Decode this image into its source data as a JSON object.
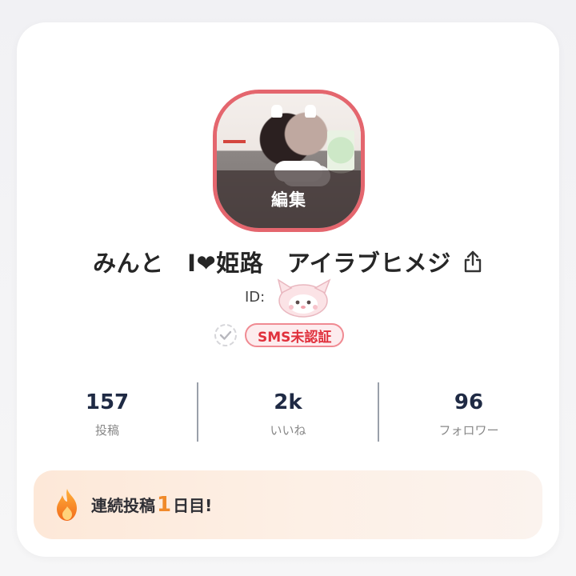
{
  "profile": {
    "edit_label": "編集",
    "username": "みんと　I❤姫路　アイラブヒメジ",
    "id_label": "ID:"
  },
  "verification": {
    "sms_badge": "SMS未認証"
  },
  "stats": [
    {
      "value": "157",
      "label": "投稿"
    },
    {
      "value": "2k",
      "label": "いいね"
    },
    {
      "value": "96",
      "label": "フォロワー"
    }
  ],
  "streak": {
    "prefix": "連続投稿",
    "count": "1",
    "suffix": "日目!"
  },
  "colors": {
    "avatar_border": "#e4666e",
    "sms_text": "#e0303c",
    "streak_number": "#f08a2a",
    "stat_value": "#1f2a44"
  },
  "icons": {
    "share": "share-icon",
    "check": "check-circle-icon",
    "flame": "flame-icon"
  }
}
